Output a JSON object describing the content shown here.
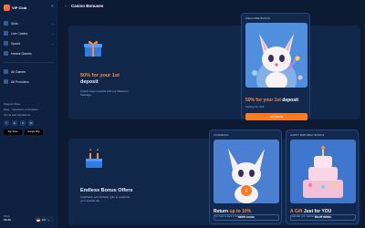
{
  "brand": {
    "name": "VIP Club"
  },
  "sidebar": {
    "items": [
      {
        "label": "Slots",
        "icon": "slot-icon",
        "has_chevron": true
      },
      {
        "label": "Live Casino",
        "icon": "cards-icon",
        "has_chevron": true
      },
      {
        "label": "Sports",
        "icon": "ball-icon",
        "has_chevron": true
      },
      {
        "label": "Instant Games",
        "icon": "rocket-icon",
        "has_chevron": false
      }
    ],
    "items2": [
      {
        "label": "All Games",
        "icon": "grid-icon"
      },
      {
        "label": "All Providers",
        "icon": "providers-icon"
      }
    ],
    "support": [
      "Support Chat",
      "FAQ – Questions & Answers",
      "Terms and Conditions"
    ],
    "socials": [
      "f",
      "in",
      "X",
      "✉"
    ],
    "apps": [
      "App Store",
      "Google Play"
    ],
    "clock_label": "Time",
    "clock_time": "19:43",
    "lang": "EN"
  },
  "header": {
    "title": "Casino Bonuses"
  },
  "panel1": {
    "title_hl": "50% for your 1st",
    "title_rest": "deposit",
    "desc": "Unlock huge rewards with our Welcome Package"
  },
  "panel2": {
    "title": "Endless Bonus Offers",
    "desc": "Cashback, and birthday gifts to celebrate your special day"
  },
  "card_welcome": {
    "tag": "Welcome Bonus",
    "title_hl": "50% for your 1st",
    "title_rest": "deposit",
    "sub": "Starting from 20 €",
    "button": "ACTIVATE"
  },
  "card_cashback": {
    "tag": "Cashback",
    "title_plain": "Return",
    "title_hl": "up to 10%",
    "sub": "Your cash is back in the game",
    "button": "READ MORE"
  },
  "card_birthday": {
    "tag": "Happy Birthday Bonus",
    "title_hl": "A Gift",
    "title_rest": "Just for YOU",
    "sub": "Celebrate your special day with extra",
    "button": "READ MORE"
  },
  "colors": {
    "accent": "#ff7a22",
    "bg": "#0c1a33",
    "panel": "#112749"
  }
}
